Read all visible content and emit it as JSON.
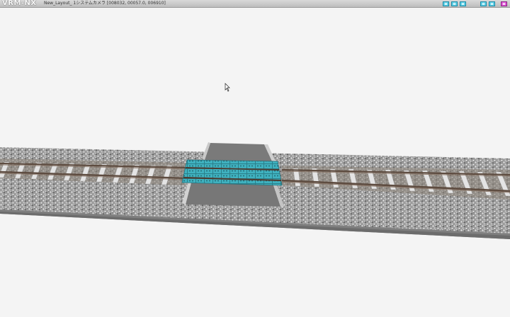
{
  "window": {
    "app_name": "VRM-NX",
    "title": "New_Layout_ 1システムカメラ [008032, 00057.0, 006910]"
  },
  "toolbar": {
    "icons": [
      "view-mode-1-icon",
      "view-mode-2-icon",
      "view-mode-3-icon",
      "window-mode-icon",
      "fullscreen-icon",
      "menu-dropdown-icon"
    ]
  },
  "colors": {
    "sky": "#f4f4f4",
    "ballast": "#a9a9a9",
    "rail": "#6b5a4e",
    "sleeper": "#e2e2e2",
    "crossing_deck": "#3fb1bf",
    "road": "#777777",
    "base_edge": "#8a8a8a"
  },
  "scene": {
    "objects": [
      "track-base",
      "ballast-bed",
      "straight-track-left",
      "straight-track-right",
      "level-crossing",
      "road-ramp"
    ]
  }
}
